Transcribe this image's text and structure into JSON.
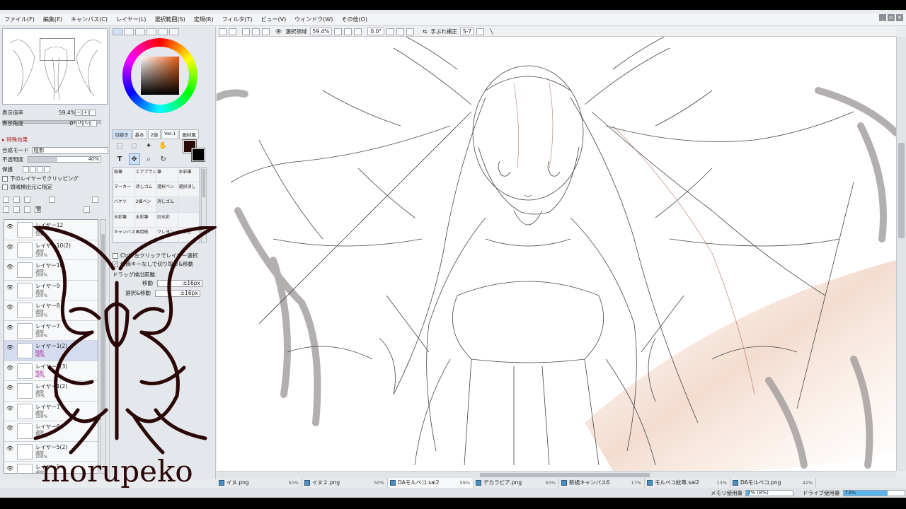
{
  "menu": [
    "ファイル(F)",
    "編集(E)",
    "キャンバス(C)",
    "レイヤー(L)",
    "選択範囲(S)",
    "定規(R)",
    "フィルタ(T)",
    "ビュー(V)",
    "ウィンドウ(W)",
    "その他(O)"
  ],
  "navigator": {
    "zoom_label": "表示倍率",
    "zoom_value": "59.4%",
    "angle_label": "表示角度",
    "angle_value": "0°"
  },
  "layer_props": {
    "effect_label": "特殊効果",
    "blend_label": "合成モード",
    "blend_value": "陰影",
    "opacity_label": "不透明度",
    "opacity_value": "40%",
    "opacity_fraction": 0.4,
    "protect_label": "保護",
    "clip_label": "下のレイヤーでクリッピング",
    "source_label": "領域検出元に指定"
  },
  "layers": [
    {
      "name": "レイヤー12",
      "mode": "通常",
      "opacity": "100%",
      "selected": false
    },
    {
      "name": "レイヤー10(2)",
      "mode": "通常",
      "opacity": "100%",
      "selected": false
    },
    {
      "name": "レイヤー10",
      "mode": "通常",
      "opacity": "100%",
      "selected": false
    },
    {
      "name": "レイヤー9",
      "mode": "通常",
      "opacity": "100%",
      "selected": false
    },
    {
      "name": "レイヤー8",
      "mode": "通常",
      "opacity": "100%",
      "selected": false
    },
    {
      "name": "レイヤー7",
      "mode": "通常",
      "opacity": "100%",
      "selected": false
    },
    {
      "name": "レイヤー1(2)",
      "mode": "陰影",
      "opacity": "40%",
      "selected": true
    },
    {
      "name": "レイヤー1(3)",
      "mode": "陰影",
      "opacity": "40%",
      "selected": false
    },
    {
      "name": "レイヤー1(2)",
      "mode": "通常",
      "opacity": "15%",
      "selected": false
    },
    {
      "name": "レイヤー1",
      "mode": "通常",
      "opacity": "100%",
      "selected": false
    },
    {
      "name": "レイヤー6",
      "mode": "通常",
      "opacity": "100%",
      "selected": false
    },
    {
      "name": "レイヤー5(2)",
      "mode": "通常",
      "opacity": "100%",
      "selected": false
    },
    {
      "name": "レイヤー5",
      "mode": "通常",
      "opacity": "100%",
      "selected": false
    }
  ],
  "tool_tabs": [
    "引線き",
    "基本",
    "2値",
    "Ver.1",
    "画材風"
  ],
  "brushes": [
    "鉛筆",
    "エアブラシ",
    "筆",
    "水彩筆",
    "マーカー",
    "消しゴム",
    "選択ペン",
    "選択消し",
    "バケツ",
    "2値ペン",
    "消しゴム",
    "",
    "水彩筆",
    "水彩筆",
    "旧水彩",
    "",
    "キャンバス",
    "画用紙",
    "クレヨン",
    "ぼかし"
  ],
  "tool_options": {
    "ctrl_select": "Ctrl+左クリックでレイヤー選択",
    "modifier_toggle": "修飾キーなしで切り取り&移動",
    "drag_label": "ドラッグ検出距離:",
    "move_label": "移動",
    "move_value": "±16px",
    "select_move_label": "選択&移動",
    "select_move_value": "±16px"
  },
  "toolbar": {
    "selection_label": "選択領域",
    "zoom_value": "59.4%",
    "angle_value": "0.0°",
    "stabilizer_label": "手ぶれ補正",
    "stabilizer_value": "S-7"
  },
  "file_tabs": [
    {
      "name": "イヌ.png",
      "pct": "50%",
      "active": false
    },
    {
      "name": "イヌ２.png",
      "pct": "50%",
      "active": false
    },
    {
      "name": "DAモルペコ.sai2",
      "pct": "59%",
      "active": true
    },
    {
      "name": "デカラビア.png",
      "pct": "50%",
      "active": false
    },
    {
      "name": "新規キャンバス6",
      "pct": "17%",
      "active": false
    },
    {
      "name": "モルペコ紋章.sai2",
      "pct": "13%",
      "active": false
    },
    {
      "name": "DAモルペコ.png",
      "pct": "42%",
      "active": false
    }
  ],
  "status": {
    "memory_label": "メモリ使用量",
    "memory_value": "7% (8%)",
    "memory_fraction": 0.08,
    "drive_label": "ドライブ使用量",
    "drive_value": "73%",
    "drive_fraction": 0.73
  },
  "watermark_text": "morupeko",
  "colors": {
    "foreground": "#2a0a04",
    "background": "#000000",
    "selected_layer": "#d6dcf0",
    "scroll_thumb": "#b7bcc2"
  }
}
